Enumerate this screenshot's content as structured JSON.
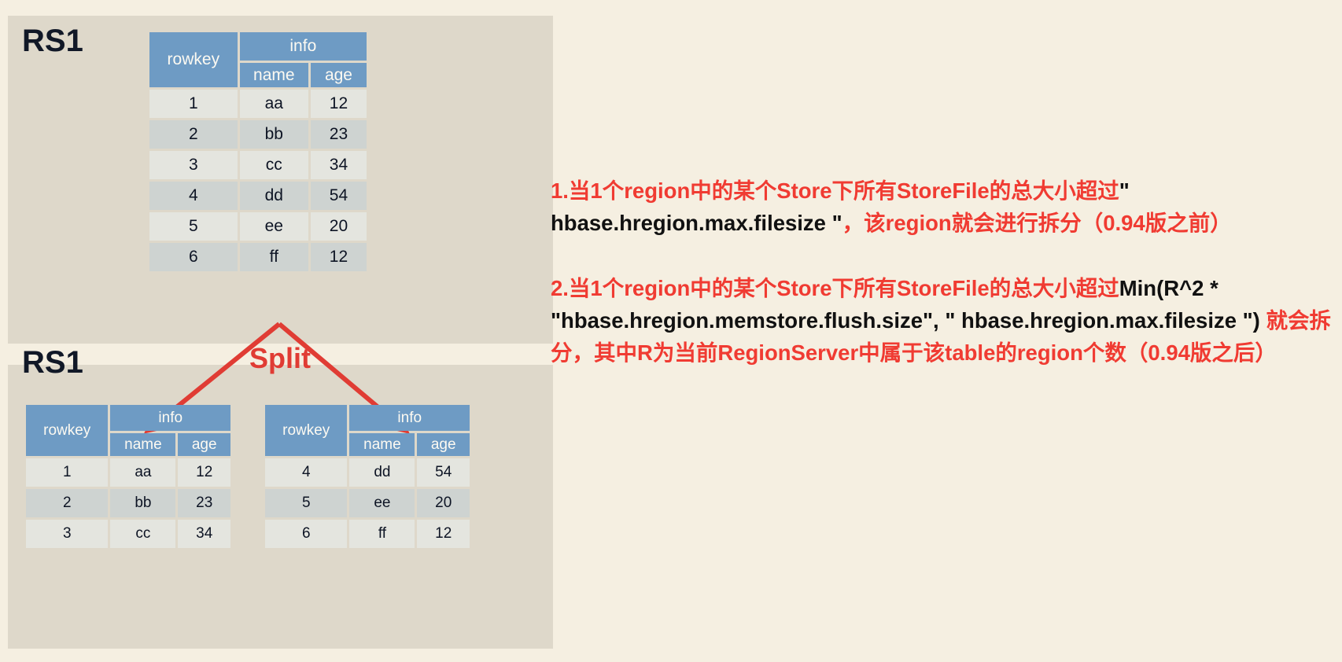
{
  "slide": {
    "background_color": "#f5efe1",
    "panel_color": "#ded8ca",
    "accent_red": "#f03b32",
    "header_blue": "#6e9bc4"
  },
  "panels": {
    "top": {
      "label": "RS1"
    },
    "bottom": {
      "label": "RS1"
    }
  },
  "split": {
    "label": "Split",
    "arrow_color": "#e03c34"
  },
  "tables": {
    "main": {
      "rowkey_header": "rowkey",
      "group_header": "info",
      "sub_headers": [
        "name",
        "age"
      ],
      "rows": [
        {
          "rowkey": "1",
          "name": "aa",
          "age": "12"
        },
        {
          "rowkey": "2",
          "name": "bb",
          "age": "23"
        },
        {
          "rowkey": "3",
          "name": "cc",
          "age": "34"
        },
        {
          "rowkey": "4",
          "name": "dd",
          "age": "54"
        },
        {
          "rowkey": "5",
          "name": "ee",
          "age": "20"
        },
        {
          "rowkey": "6",
          "name": "ff",
          "age": "12"
        }
      ]
    },
    "left": {
      "rowkey_header": "rowkey",
      "group_header": "info",
      "sub_headers": [
        "name",
        "age"
      ],
      "rows": [
        {
          "rowkey": "1",
          "name": "aa",
          "age": "12"
        },
        {
          "rowkey": "2",
          "name": "bb",
          "age": "23"
        },
        {
          "rowkey": "3",
          "name": "cc",
          "age": "34"
        }
      ]
    },
    "right": {
      "rowkey_header": "rowkey",
      "group_header": "info",
      "sub_headers": [
        "name",
        "age"
      ],
      "rows": [
        {
          "rowkey": "4",
          "name": "dd",
          "age": "54"
        },
        {
          "rowkey": "5",
          "name": "ee",
          "age": "20"
        },
        {
          "rowkey": "6",
          "name": "ff",
          "age": "12"
        }
      ]
    }
  },
  "notes": {
    "para1": {
      "segment1": "1.当1个region中的某个Store下所有StoreFile的总大小超过",
      "segment_mono": "\" hbase.hregion.max.filesize \"",
      "segment2": "，该region就会进行拆分（0.94版之前）"
    },
    "para2": {
      "segment1": "2.当1个region中的某个Store下所有StoreFile的总大小超过",
      "segment_mono": "Min(R^2 * \"hbase.hregion.memstore.flush.size\", \" hbase.hregion.max.filesize \")",
      "segment2": " 就会拆分，其中R为当前RegionServer中属于该table的region个数（0.94版之后）"
    }
  }
}
